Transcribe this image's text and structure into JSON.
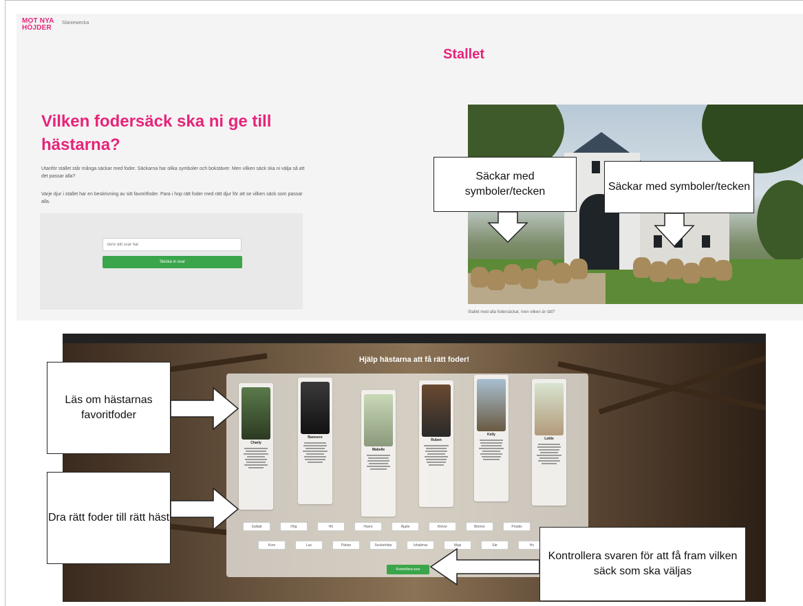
{
  "header": {
    "logo_line1": "MOT NYA",
    "logo_line2": "HÖJDER",
    "nav_link": "Slaniewecka"
  },
  "page": {
    "title": "Stallet",
    "headline": "Vilken fodersäck ska ni ge till hästarna?",
    "intro_1": "Utanför stallet står många säckar med foder. Säckarna har olika symboler och bokstäver. Men vilken säck ska ni välja så att det passar alla?",
    "intro_2": "Varje djur i stallet har en beskrivning av sitt favoritfoder. Para i hop rätt foder med rätt djur för att se vilken säck som passar alla."
  },
  "form": {
    "input_placeholder": "Skriv ditt svar här",
    "submit_label": "Skicka in svar"
  },
  "image": {
    "caption": "Stallet med alla fodersäckar, men vilken är rätt?"
  },
  "game": {
    "title": "Hjälp hästarna att få rätt foder!",
    "horses": [
      {
        "name": "Charly"
      },
      {
        "name": "Bamsero"
      },
      {
        "name": "Mabelle"
      },
      {
        "name": "Ruben"
      },
      {
        "name": "Kelly"
      },
      {
        "name": "Lottie"
      }
    ],
    "foods_row1": [
      "Salladi",
      "Hög",
      "Hö",
      "Havre",
      "Äpple",
      "Klöver",
      "Blomor",
      "Potatis"
    ],
    "foods_row2": [
      "Korn",
      "Lax",
      "Pärlan",
      "Sockerbitar",
      "Ishaltmat",
      "Majs",
      "Sär",
      "Ho"
    ],
    "check_label": "Kontrollera svar"
  },
  "callouts": {
    "sacks_left": "Säckar med symboler/tecken",
    "sacks_right": "Säckar med symboler/tecken",
    "read_horses": "Läs om hästarnas favoritfoder",
    "drag_food": "Dra rätt foder till rätt häst",
    "check_answers": "Kontrollera svaren för att få fram vilken säck som ska väljas"
  },
  "colors": {
    "brand_pink": "#e6247a",
    "button_green": "#3aa54b"
  }
}
